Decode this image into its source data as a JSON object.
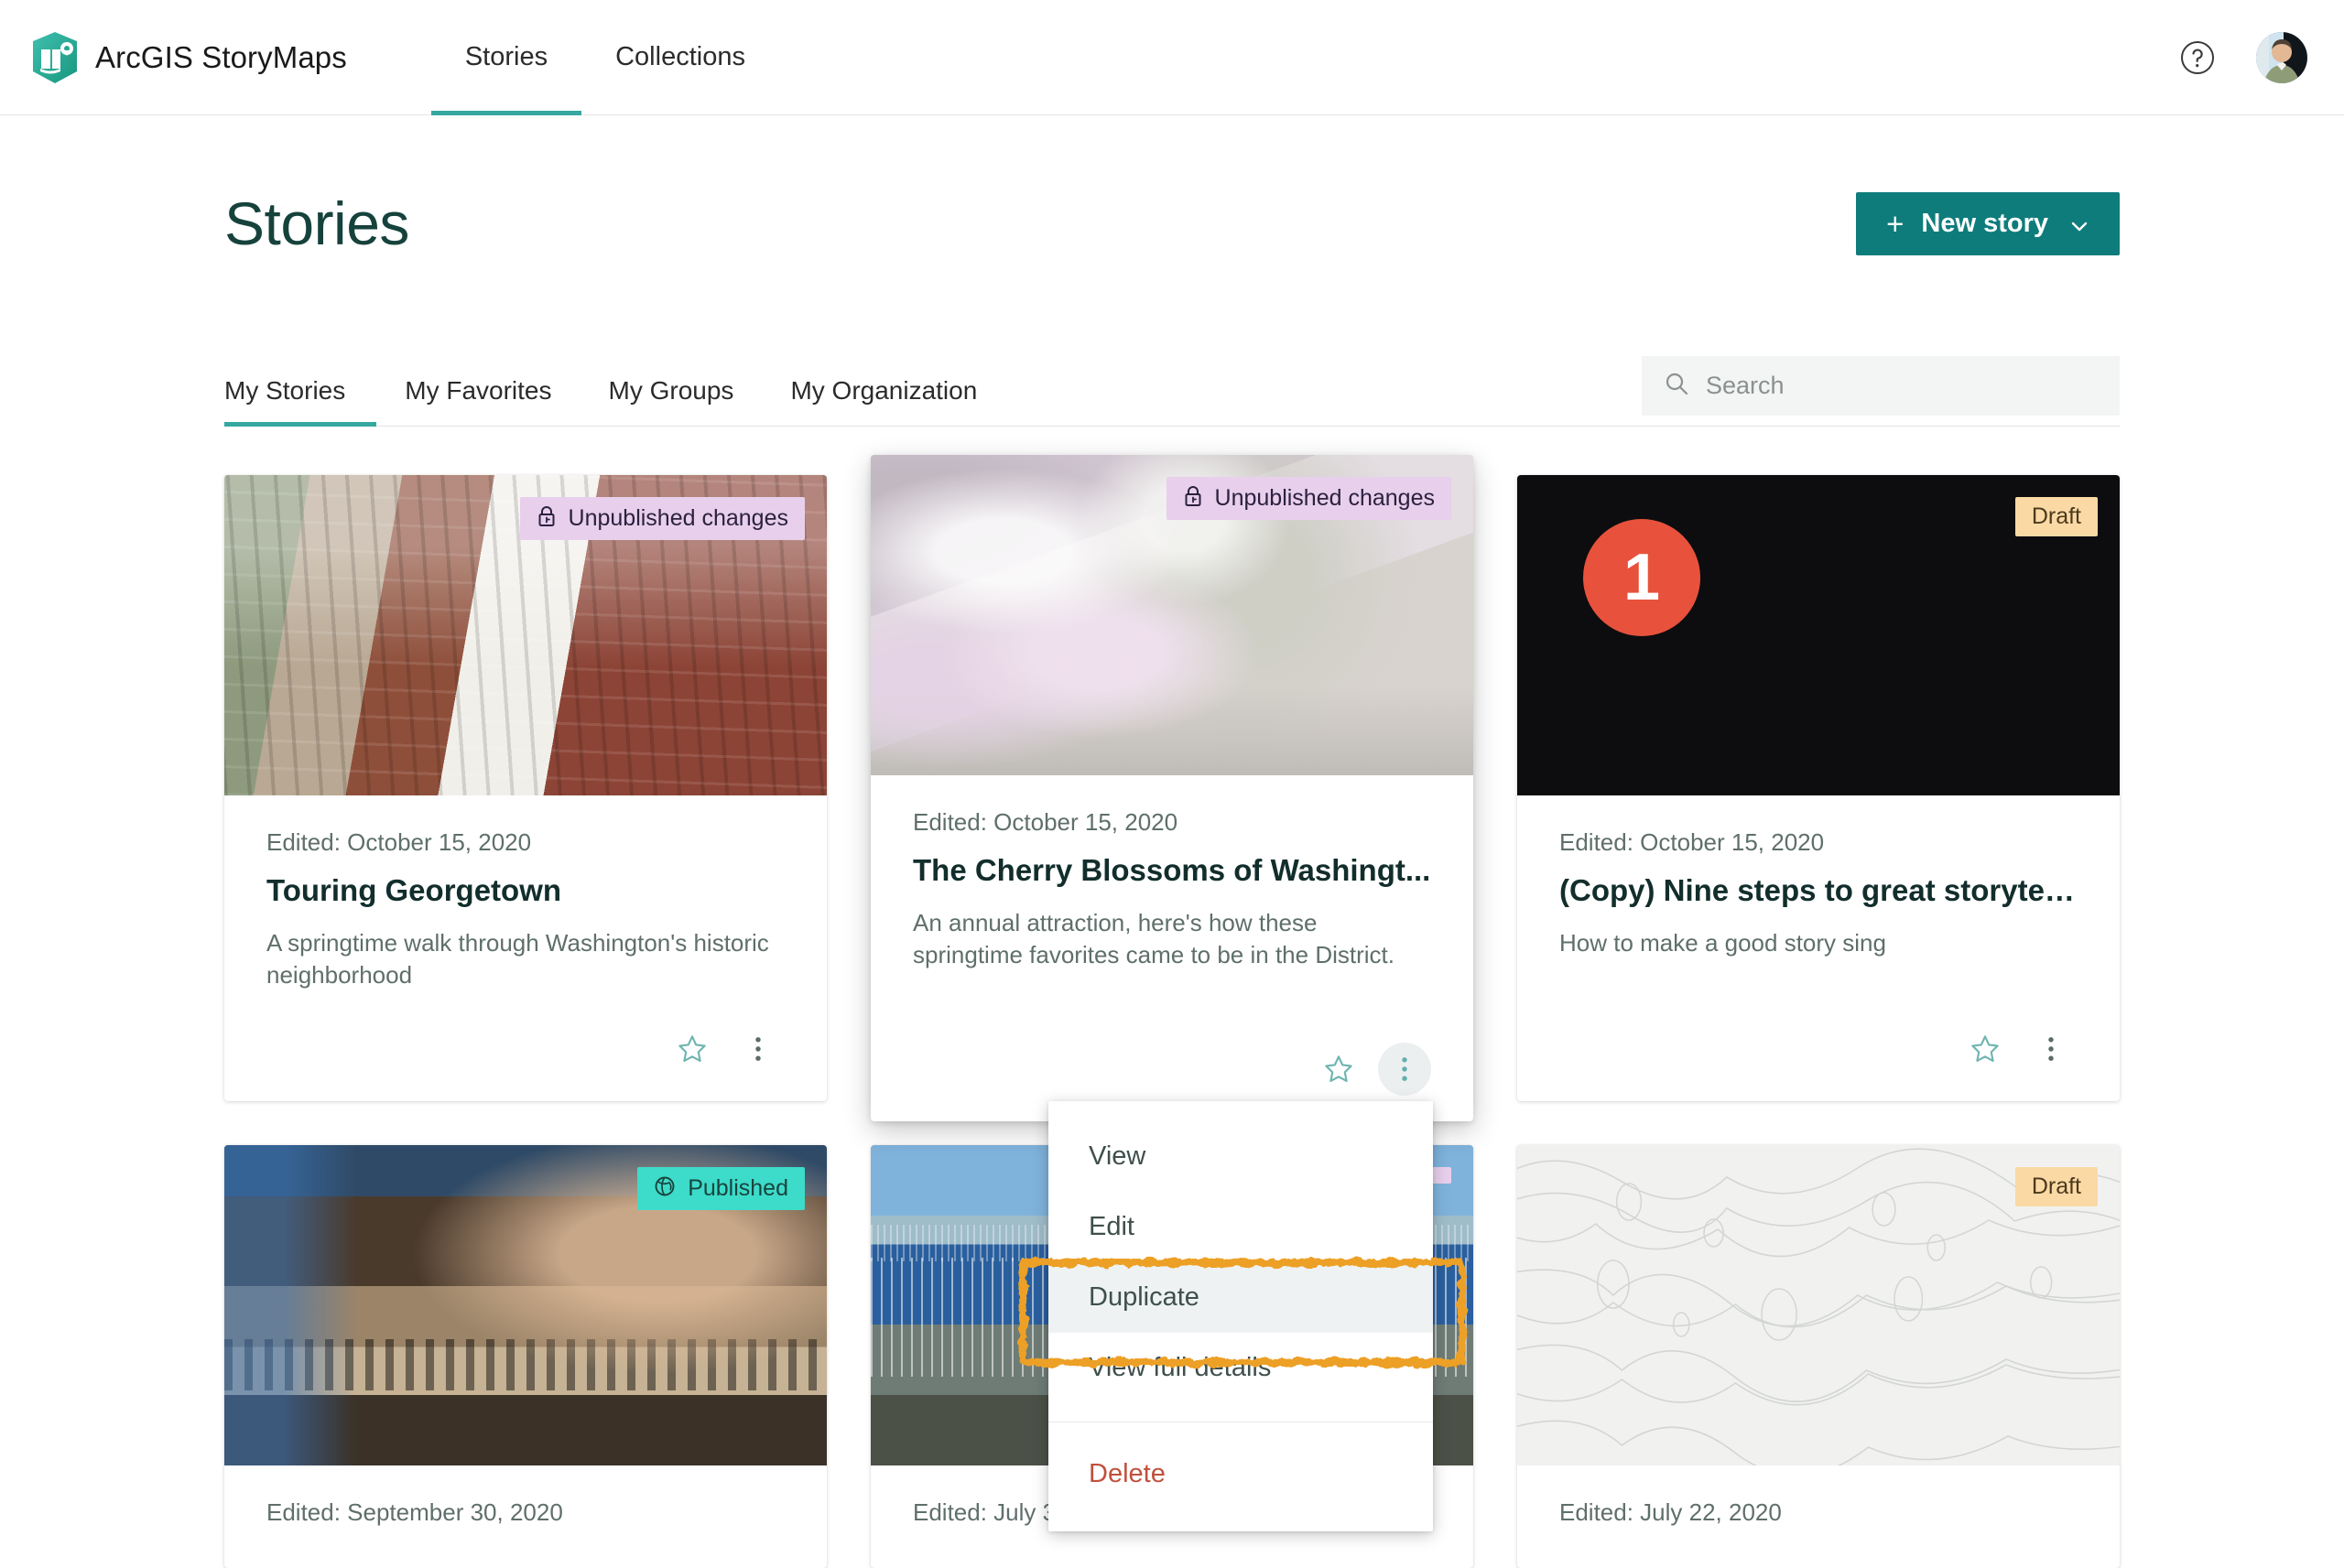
{
  "header": {
    "brand_name": "ArcGIS StoryMaps",
    "logo_icon": "storymaps-logo-icon",
    "nav": [
      {
        "label": "Stories",
        "active": true
      },
      {
        "label": "Collections",
        "active": false
      }
    ],
    "help_icon": "help-question-icon",
    "avatar_icon": "user-avatar"
  },
  "page": {
    "title": "Stories",
    "new_story": {
      "label": "New story",
      "plus": "+",
      "chevron_icon": "chevron-down-icon"
    }
  },
  "filters": {
    "tabs": [
      {
        "label": "My Stories",
        "active": true
      },
      {
        "label": "My Favorites",
        "active": false
      },
      {
        "label": "My Groups",
        "active": false
      },
      {
        "label": "My Organization",
        "active": false
      }
    ],
    "search": {
      "placeholder": "Search",
      "value": "",
      "icon": "search-icon"
    }
  },
  "cards": [
    {
      "badge": {
        "text": "Unpublished changes",
        "type": "unpublished",
        "icon": "lock-icon"
      },
      "edited": "Edited: October 15, 2020",
      "title": "Touring Georgetown",
      "summary": "A springtime walk through Washington's historic neighborhood",
      "favorite_icon": "star-outline-icon",
      "menu_icon": "kebab-menu-icon"
    },
    {
      "badge": {
        "text": "Unpublished changes",
        "type": "unpublished",
        "icon": "lock-icon"
      },
      "edited": "Edited: October 15, 2020",
      "title": "The Cherry Blossoms of Washingt...",
      "summary": "An annual attraction, here's how these springtime favorites came to be in the District.",
      "favorite_icon": "star-outline-icon",
      "menu_icon": "kebab-menu-icon"
    },
    {
      "badge": {
        "text": "Draft",
        "type": "draft",
        "icon": ""
      },
      "edited": "Edited: October 15, 2020",
      "title": "(Copy) Nine steps to great storytel...",
      "summary": "How to make a good story sing",
      "number_bubble": "1",
      "favorite_icon": "star-outline-icon",
      "menu_icon": "kebab-menu-icon"
    },
    {
      "badge": {
        "text": "Published",
        "type": "published",
        "icon": "globe-icon"
      },
      "edited": "Edited: September 30, 2020",
      "title": "",
      "summary": "",
      "favorite_icon": "star-outline-icon",
      "menu_icon": "kebab-menu-icon"
    },
    {
      "badge": {
        "text": "",
        "type": "unpublished",
        "icon": ""
      },
      "edited": "Edited: July 3",
      "title": "",
      "summary": "",
      "favorite_icon": "star-outline-icon",
      "menu_icon": "kebab-menu-icon"
    },
    {
      "badge": {
        "text": "Draft",
        "type": "draft",
        "icon": ""
      },
      "edited": "Edited: July 22, 2020",
      "title": "",
      "summary": "",
      "favorite_icon": "star-outline-icon",
      "menu_icon": "kebab-menu-icon"
    }
  ],
  "context_menu": {
    "items": [
      {
        "label": "View",
        "highlighted": false,
        "danger": false
      },
      {
        "label": "Edit",
        "highlighted": false,
        "danger": false
      },
      {
        "label": "Duplicate",
        "highlighted": true,
        "danger": false
      },
      {
        "label": "View full details",
        "highlighted": false,
        "danger": false
      },
      {
        "label": "Delete",
        "highlighted": false,
        "danger": true
      }
    ]
  },
  "colors": {
    "brand_teal": "#0f7c7c",
    "accent_teal": "#35a8a0",
    "title_dark": "#16423c",
    "badge_unpublished": "#e8cfec",
    "badge_published": "#3ddbc9",
    "badge_draft": "#fbd9a5",
    "danger_red": "#c0503c",
    "annotation_orange": "#eda026",
    "number_bubble_red": "#e8523c"
  }
}
